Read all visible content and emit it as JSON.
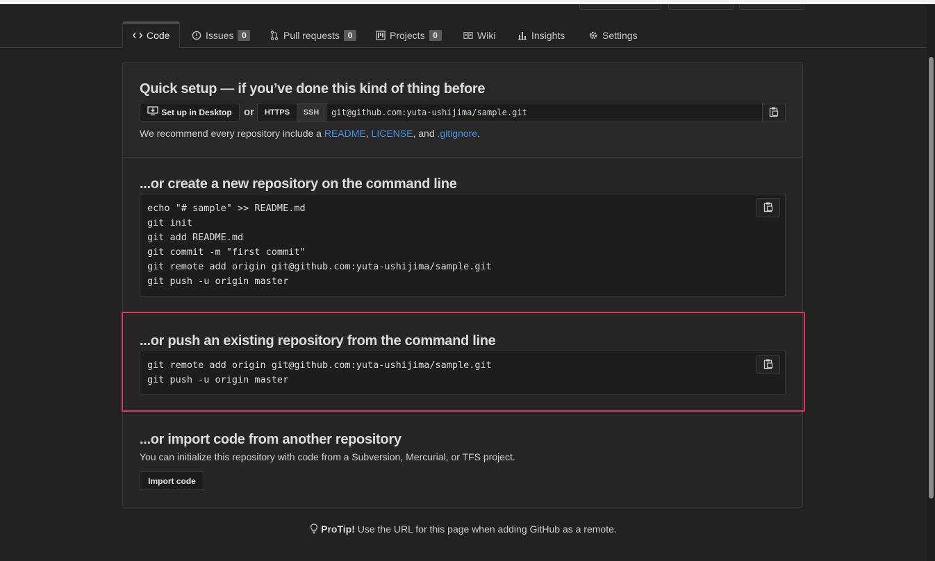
{
  "tabs": [
    {
      "label": "Code",
      "icon": "code-icon"
    },
    {
      "label": "Issues",
      "icon": "issue-opened-icon",
      "count": "0"
    },
    {
      "label": "Pull requests",
      "icon": "git-pull-request-icon",
      "count": "0"
    },
    {
      "label": "Projects",
      "icon": "project-icon",
      "count": "0"
    },
    {
      "label": "Wiki",
      "icon": "book-icon"
    },
    {
      "label": "Insights",
      "icon": "graph-icon"
    },
    {
      "label": "Settings",
      "icon": "gear-icon"
    }
  ],
  "quick_setup": {
    "title": "Quick setup — if you’ve done this kind of thing before",
    "desktop_button": "Set up in Desktop",
    "or": "or",
    "https_label": "HTTPS",
    "ssh_label": "SSH",
    "url": "git@github.com:yuta-ushijima/sample.git",
    "recommend_prefix": "We recommend every repository include a ",
    "readme": "README",
    "sep1": ", ",
    "license": "LICENSE",
    "sep2": ", and ",
    "gitignore": ".gitignore",
    "suffix": "."
  },
  "create_new": {
    "title": "...or create a new repository on the command line",
    "code": "echo \"# sample\" >> README.md\ngit init\ngit add README.md\ngit commit -m \"first commit\"\ngit remote add origin git@github.com:yuta-ushijima/sample.git\ngit push -u origin master"
  },
  "push_existing": {
    "title": "...or push an existing repository from the command line",
    "code": "git remote add origin git@github.com:yuta-ushijima/sample.git\ngit push -u origin master"
  },
  "import_code": {
    "title": "...or import code from another repository",
    "description": "You can initialize this repository with code from a Subversion, Mercurial, or TFS project.",
    "button": "Import code"
  },
  "protip": {
    "label": "ProTip!",
    "text": " Use the URL for this page when adding GitHub as a remote."
  },
  "colors": {
    "highlight_border": "#e8325f",
    "link": "#4a90e2",
    "background": "#222222"
  }
}
